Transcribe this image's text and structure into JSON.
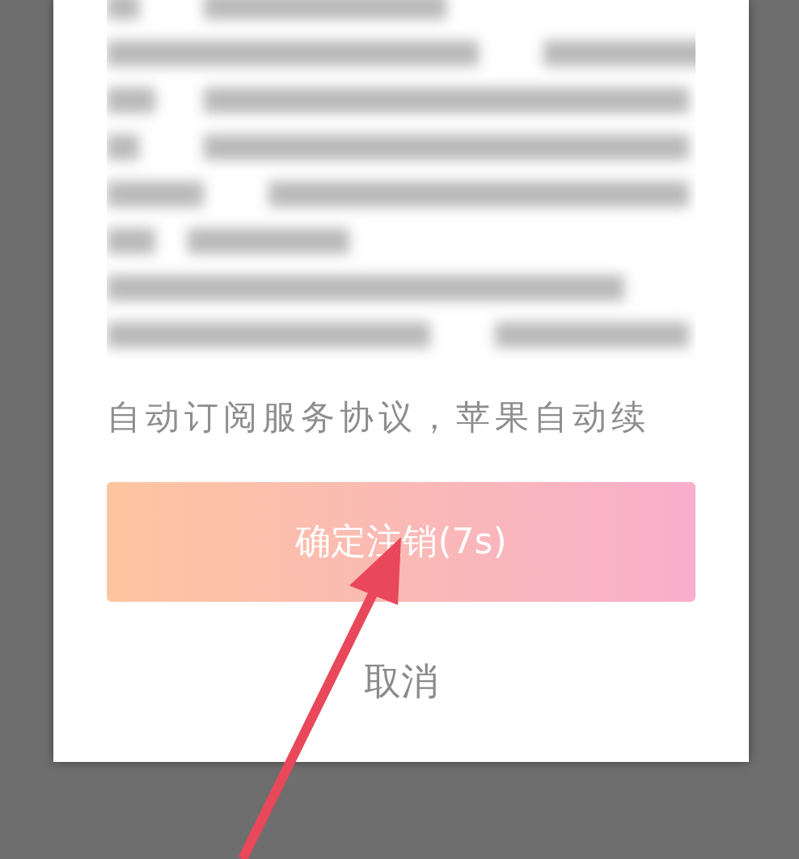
{
  "dialog": {
    "body_last_line": "自动订阅服务协议，苹果自动续",
    "confirm_button": "确定注销(7s)",
    "cancel_button": "取消"
  }
}
